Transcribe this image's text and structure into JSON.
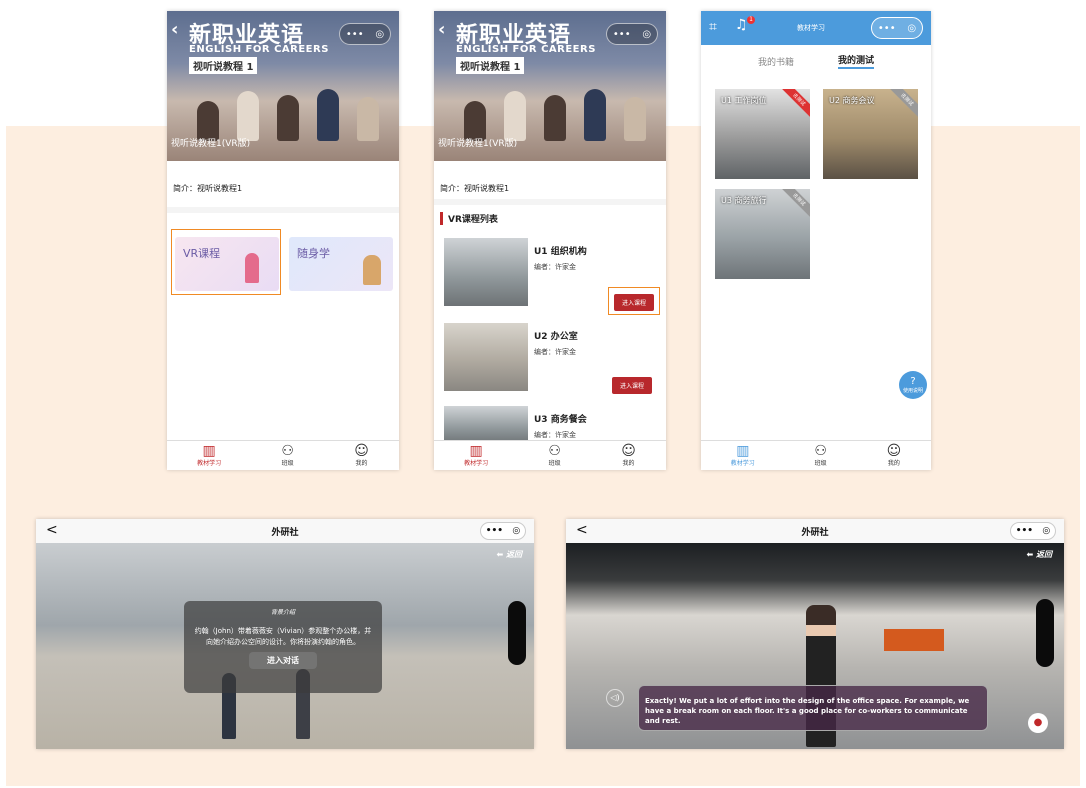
{
  "colors": {
    "accent_red": "#c0282a",
    "blue": "#4c9bdc",
    "band": "#fdeee0"
  },
  "book": {
    "title_cn": "新职业英语",
    "title_en": "ENGLISH FOR CAREERS",
    "course": "视听说教程",
    "volume": "1",
    "label": "视听说教程1(VR版)",
    "intro": "简介：视听说教程1"
  },
  "phone1": {
    "cards": [
      {
        "label": "VR课程"
      },
      {
        "label": "随身学"
      }
    ]
  },
  "phone2": {
    "section": "VR课程列表",
    "items": [
      {
        "name": "U1 组织机构",
        "editor": "编者：许家金",
        "btn": "进入课程"
      },
      {
        "name": "U2 办公室",
        "editor": "编者：许家金",
        "btn": "进入课程"
      },
      {
        "name": "U3 商务餐会",
        "editor": "编者：许家金"
      }
    ]
  },
  "phone3": {
    "title": "教材学习",
    "tabs": [
      "我的书籍",
      "我的测试"
    ],
    "cards": [
      {
        "label": "U1 工作岗位",
        "ribbon": "去测试"
      },
      {
        "label": "U2 商务会议",
        "ribbon": "去测试"
      },
      {
        "label": "U3 商务旅行",
        "ribbon": "去测试"
      }
    ],
    "help": "使用说明",
    "badge": "1"
  },
  "tabbar": [
    {
      "label": "教材学习",
      "icon": "book-icon"
    },
    {
      "label": "班级",
      "icon": "group-icon"
    },
    {
      "label": "我的",
      "icon": "user-icon"
    }
  ],
  "capsule": {
    "dots": "•••",
    "target": "◎"
  },
  "vr": {
    "title": "外研社",
    "back": "<",
    "return_label": "返回",
    "modal": {
      "title": "背景介绍",
      "body": "约翰（John）带着薇薇安（Vivian）参观整个办公楼，并向她介绍办公空间的设计。你将扮演约翰的角色。",
      "enter": "进入对话"
    },
    "subtitle": "Exactly! We put a lot of effort into the design of the office space. For example, we have a break room on each floor. It's a good place for co-workers to communicate and rest."
  }
}
